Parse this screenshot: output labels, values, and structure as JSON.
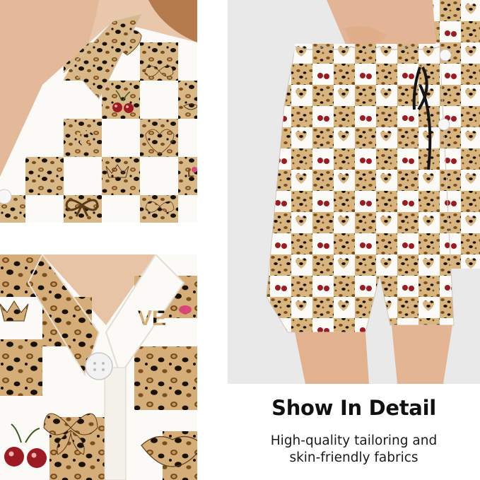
{
  "image": {
    "description_panels": [
      "collar-closeup",
      "fabric-closeup",
      "shorts-view"
    ],
    "pattern_icons": [
      "heart",
      "butterfly",
      "cherries",
      "crown",
      "bow",
      "lips",
      "paw",
      "love"
    ]
  },
  "caption": {
    "title": "Show In Detail",
    "subtitle_line1": "High-quality tailoring and",
    "subtitle_line2": "skin-friendly fabrics"
  },
  "colors": {
    "leopard_base": "#d9b887",
    "leopard_spot": "#1a1208",
    "leopard_ring": "#7a4e1f",
    "tile_white": "#fbfaf7",
    "skin": "#e9c4a8",
    "cherry": "#9c1b22",
    "pink_accent": "#d9477a",
    "drawstring": "#141414"
  }
}
